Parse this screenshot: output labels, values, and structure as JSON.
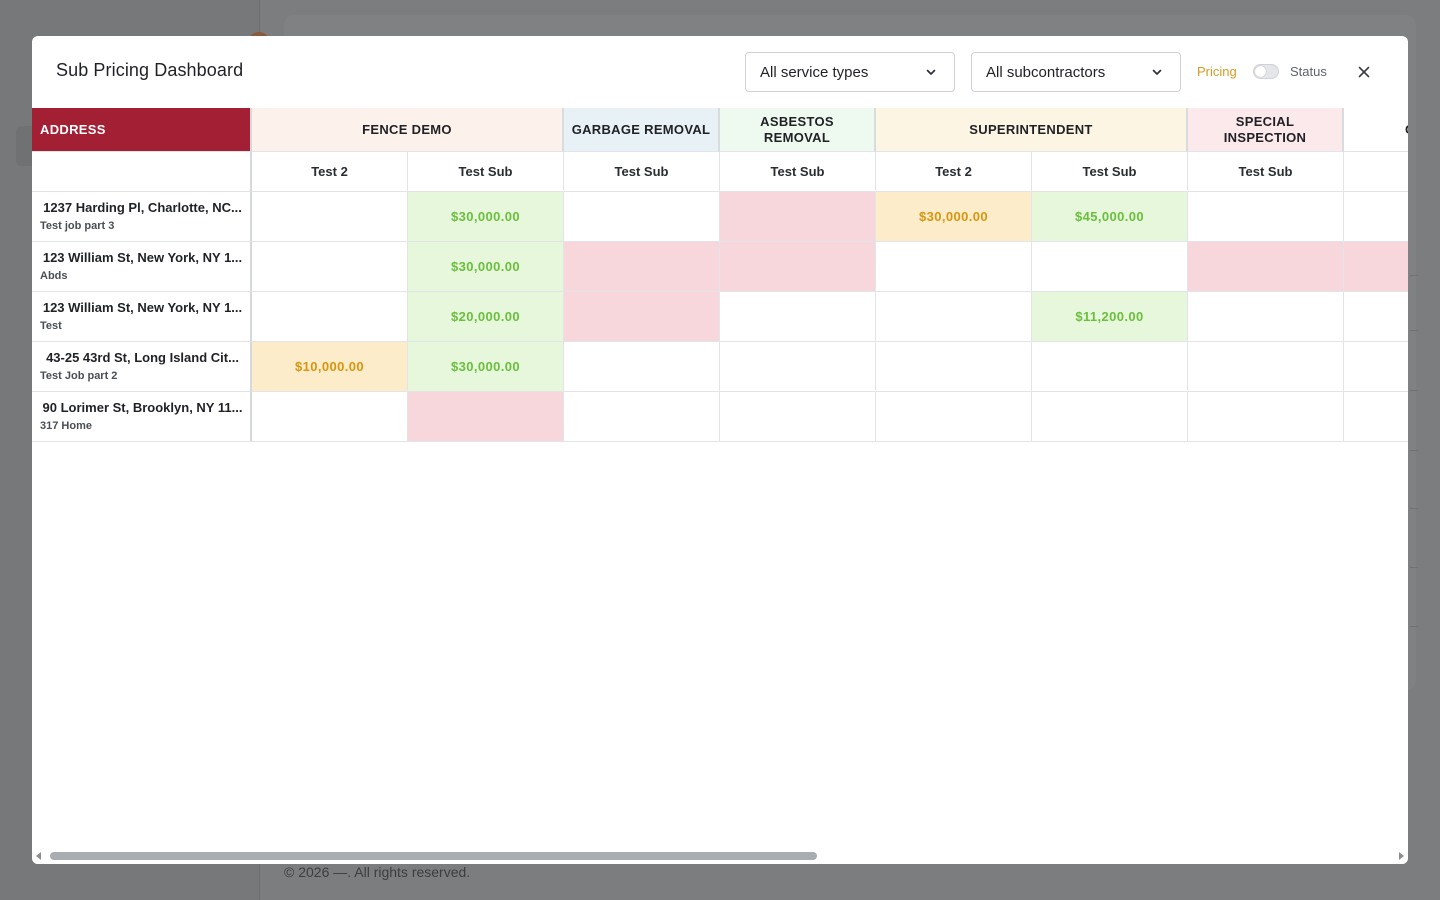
{
  "background": {
    "footer": "© 2026 —. All rights reserved."
  },
  "modal": {
    "title": "Sub Pricing Dashboard",
    "service_filter": {
      "value": "All service types"
    },
    "sub_filter": {
      "value": "All subcontractors"
    },
    "toggle": {
      "left_label": "Pricing",
      "right_label": "Status",
      "state": "Pricing"
    }
  },
  "grid": {
    "address_header": "ADDRESS",
    "service_groups": [
      {
        "label": "FENCE DEMO",
        "color": "#fdf1ec"
      },
      {
        "label": "GARBAGE REMOVAL",
        "color": "#e8f1f5"
      },
      {
        "label": "ASBESTOS REMOVAL",
        "color": "#eefaef"
      },
      {
        "label": "SUPERINTENDENT",
        "color": "#fdf5e4"
      },
      {
        "label": "SPECIAL INSPECTION",
        "color": "#fbe9ec"
      },
      {
        "label": "C CONNE",
        "color": "#ffffff"
      }
    ],
    "subcontractors": [
      "Test 2",
      "Test Sub",
      "Test Sub",
      "Test Sub",
      "Test 2",
      "Test Sub",
      "Test Sub",
      "Te"
    ],
    "rows": [
      {
        "address": "1237 Harding Pl, Charlotte, NC...",
        "job": "Test job part 3",
        "cells": [
          "",
          "$30,000.00",
          "",
          "",
          "$30,000.00",
          "$45,000.00",
          "",
          ""
        ]
      },
      {
        "address": "123 William St, New York, NY 1...",
        "job": "Abds",
        "cells": [
          "",
          "$30,000.00",
          "",
          "",
          "",
          "",
          "",
          ""
        ]
      },
      {
        "address": "123 William St, New York, NY 1...",
        "job": "Test",
        "cells": [
          "",
          "$20,000.00",
          "",
          "",
          "",
          "$11,200.00",
          "",
          ""
        ]
      },
      {
        "address": "43-25 43rd St, Long Island Cit...",
        "job": "Test Job part 2",
        "cells": [
          "$10,000.00",
          "$30,000.00",
          "",
          "",
          "",
          "",
          "",
          ""
        ]
      },
      {
        "address": "90 Lorimer St, Brooklyn, NY 11...",
        "job": "317 Home",
        "cells": [
          "",
          "",
          "",
          "",
          "",
          "",
          "",
          ""
        ]
      }
    ],
    "cell_states": [
      [
        "empty",
        "green",
        "empty",
        "red",
        "amber",
        "green",
        "empty",
        "empty"
      ],
      [
        "empty",
        "green",
        "red",
        "red",
        "empty",
        "empty",
        "red",
        "red"
      ],
      [
        "empty",
        "green",
        "red",
        "empty",
        "empty",
        "green",
        "empty",
        "empty"
      ],
      [
        "amber",
        "green",
        "empty",
        "empty",
        "empty",
        "empty",
        "empty",
        "empty"
      ],
      [
        "empty",
        "red",
        "empty",
        "empty",
        "empty",
        "empty",
        "empty",
        "empty"
      ]
    ],
    "state_colors": {
      "green": {
        "bg": "#e7f7dc",
        "fg": "#6abf3d"
      },
      "amber": {
        "bg": "#fdecca",
        "fg": "#d8960f"
      },
      "red": {
        "bg": "#f8d7dc",
        "fg": "#c94a5a"
      },
      "empty": {
        "bg": "#ffffff",
        "fg": "#1f2125"
      }
    }
  },
  "scrollbar": {
    "horizontal_position": 0
  }
}
